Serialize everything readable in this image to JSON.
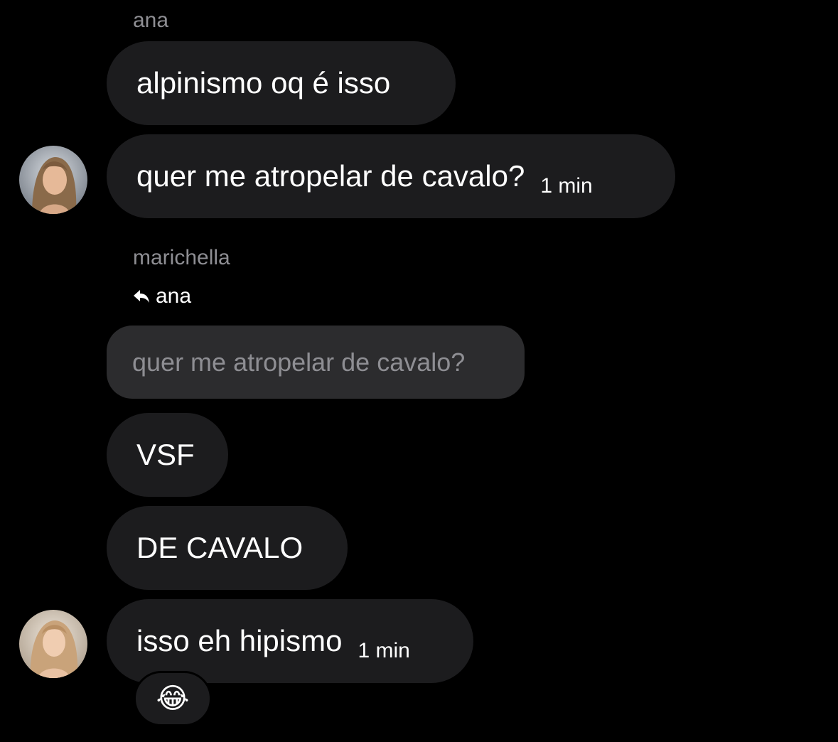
{
  "thread": {
    "group1": {
      "sender": "ana",
      "messages": [
        {
          "text": "alpinismo oq é isso"
        },
        {
          "text": "quer me atropelar de cavalo?",
          "time": "1 min"
        }
      ],
      "avatar_icon": "profile-photo-ana"
    },
    "group2": {
      "sender": "marichella",
      "reply_to": "ana",
      "quoted_text": "quer me atropelar de cavalo?",
      "messages": [
        {
          "text": "VSF"
        },
        {
          "text": "DE CAVALO"
        },
        {
          "text": "isso eh hipismo",
          "time": "1 min"
        }
      ],
      "avatar_icon": "profile-photo-marichella",
      "reaction": "😂"
    }
  },
  "colors": {
    "background": "#000000",
    "bubble": "#1c1c1e",
    "quoted_bubble": "#2c2c2e",
    "secondary_text": "#8e8e93"
  }
}
